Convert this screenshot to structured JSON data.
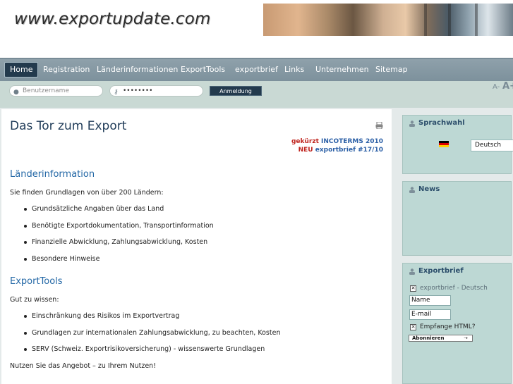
{
  "header": {
    "logo_text": "www.exportupdate.com"
  },
  "nav": {
    "items": [
      {
        "label": "Home",
        "active": true
      },
      {
        "label": "Registration"
      },
      {
        "label": "Länderinformationen"
      },
      {
        "label": "ExportTools"
      },
      {
        "label": "exportbrief"
      },
      {
        "label": "Links"
      },
      {
        "label": "Unternehmen"
      },
      {
        "label": "Sitemap"
      }
    ]
  },
  "login": {
    "username_placeholder": "Benutzername",
    "password_value": "••••••••",
    "submit_label": "Anmeldung",
    "font_smaller": "A-",
    "font_larger": "A+"
  },
  "main": {
    "title": "Das Tor zum Export",
    "news": {
      "line1_prefix": "gekürzt",
      "line1_text": "INCOTERMS 2010",
      "line2_prefix": "NEU",
      "line2_text": "exportbrief #17/10"
    },
    "sections": [
      {
        "title": "Länderinformation",
        "intro": "Sie finden Grundlagen von über 200 Ländern:",
        "bullets": [
          "Grundsätzliche Angaben über das Land",
          "Benötigte Exportdokumentation, Transportinformation",
          "Finanzielle Abwicklung, Zahlungsabwicklung, Kosten",
          "Besondere Hinweise"
        ]
      },
      {
        "title": "ExportTools",
        "intro": "Gut zu wissen:",
        "bullets": [
          "Einschränkung des Risikos im Exportvertrag",
          "Grundlagen zur internationalen Zahlungsabwicklung, zu beachten, Kosten",
          "SERV (Schweiz. Exportrisikoversicherung) - wissenswerte Grundlagen"
        ]
      }
    ],
    "footer_text": "Nutzen Sie das Angebot – zu Ihrem Nutzen!"
  },
  "sidebar": {
    "language": {
      "title": "Sprachwahl",
      "selected": "Deutsch"
    },
    "news": {
      "title": "News"
    },
    "exportbrief": {
      "title": "Exportbrief",
      "checkbox_label": "exportbrief - Deutsch",
      "name_value": "Name",
      "email_value": "E-mail",
      "html_label": "Empfange HTML?",
      "subscribe_label": "Abonnieren"
    }
  },
  "colors": {
    "nav_bg": "#8fa1ab",
    "nav_active": "#233a4d",
    "sidebar_bg": "#bdd8d4",
    "heading_blue": "#2468a6",
    "red_accent": "#c0251f"
  }
}
